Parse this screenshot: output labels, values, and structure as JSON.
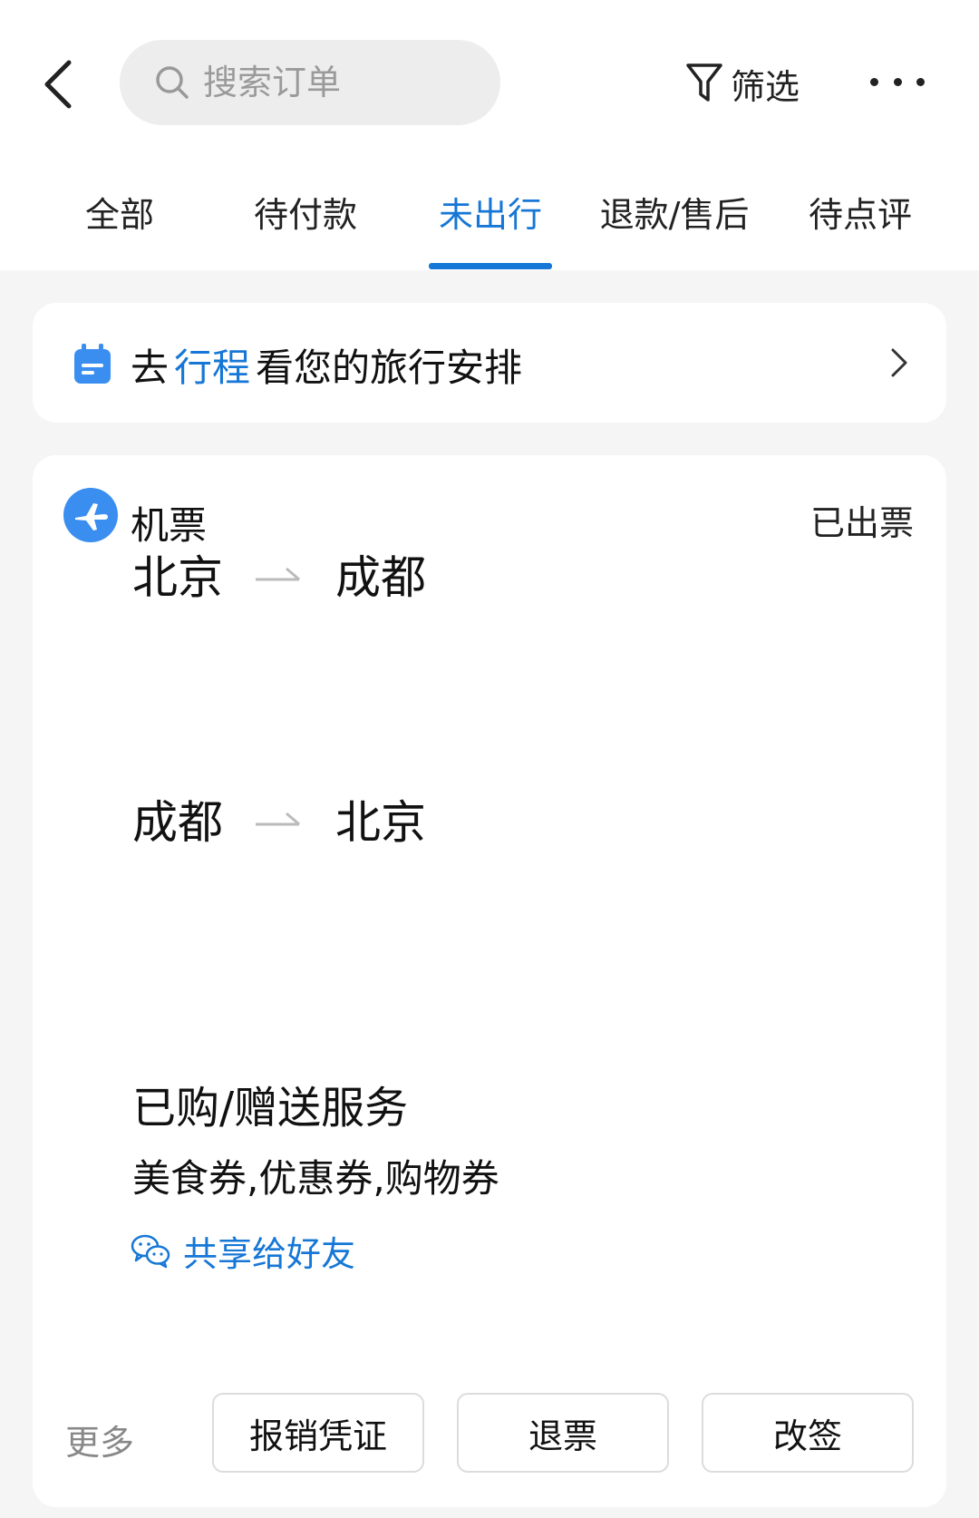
{
  "header": {
    "search_placeholder": "搜索订单",
    "filter_label": "筛选"
  },
  "tabs": [
    {
      "label": "全部"
    },
    {
      "label": "待付款"
    },
    {
      "label": "未出行",
      "active": true
    },
    {
      "label": "退款/售后"
    },
    {
      "label": "待点评"
    }
  ],
  "trip_banner": {
    "prefix": "去",
    "link": "行程",
    "suffix": "看您的旅行安排"
  },
  "order": {
    "category": "机票",
    "status": "已出票",
    "routes": [
      {
        "from": "北京",
        "to": "成都"
      },
      {
        "from": "成都",
        "to": "北京"
      }
    ],
    "services_title": "已购/赠送服务",
    "services_list": "美食券,优惠券,购物券",
    "share_label": "共享给好友",
    "more_label": "更多",
    "actions": [
      "报销凭证",
      "退票",
      "改签"
    ]
  },
  "colors": {
    "accent": "#1677d6",
    "background": "#f5f5f5",
    "card": "#ffffff"
  }
}
